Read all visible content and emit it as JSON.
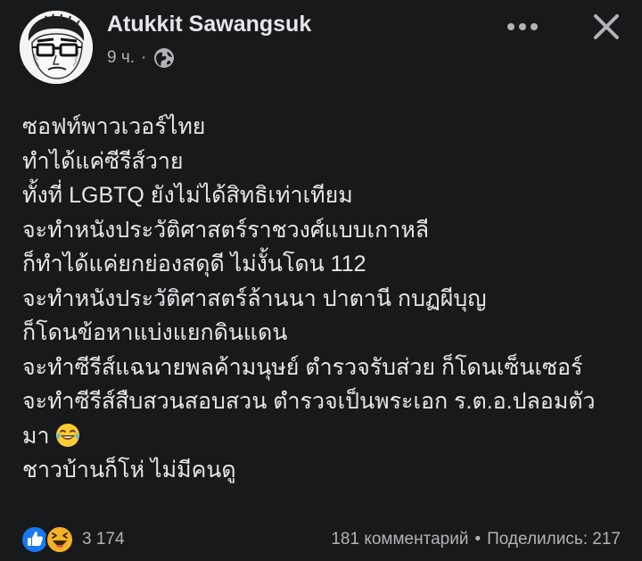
{
  "post": {
    "author": "Atukkit Sawangsuk",
    "time": "9 ч.",
    "separator": "·",
    "privacy_icon": "globe-icon",
    "lines": [
      "ซอฟท์พาวเวอร์ไทย",
      "ทำได้แค่ซีรีส์วาย",
      "ทั้งที่ LGBTQ ยังไม่ได้สิทธิเท่าเทียม",
      "จะทำหนังประวัติศาสตร์ราชวงศ์แบบเกาหลี",
      "ก็ทำได้แค่ยกย่องสดุดี ไม่งั้นโดน 112",
      "จะทำหนังประวัติศาสตร์ล้านนา ปาตานี กบฏผีบุญ",
      "ก็โดนข้อหาแบ่งแยกดินแดน",
      "จะทำซีรีส์แฉนายพลค้ามนุษย์ ตำรวจรับส่วย ก็โดนเซ็นเซอร์",
      "จะทำซีรีส์สืบสวนสอบสวน ตำรวจเป็นพระเอก ร.ต.อ.ปลอมตัว",
      "มา",
      "ชาวบ้านก็โห่ ไม่มีคนดู"
    ],
    "emoji_after_line_10": "joy-emoji"
  },
  "footer": {
    "reactions": [
      "like-icon",
      "haha-icon"
    ],
    "reaction_count": "3 174",
    "comments": "181 комментарий",
    "bullet": "•",
    "shares": "Поделились: 217"
  },
  "colors": {
    "background": "#18191a",
    "primary_text": "#e4e6eb",
    "secondary_text": "#b0b3b8",
    "like_blue": "#1877f2",
    "haha_yellow": "#f7b125"
  }
}
